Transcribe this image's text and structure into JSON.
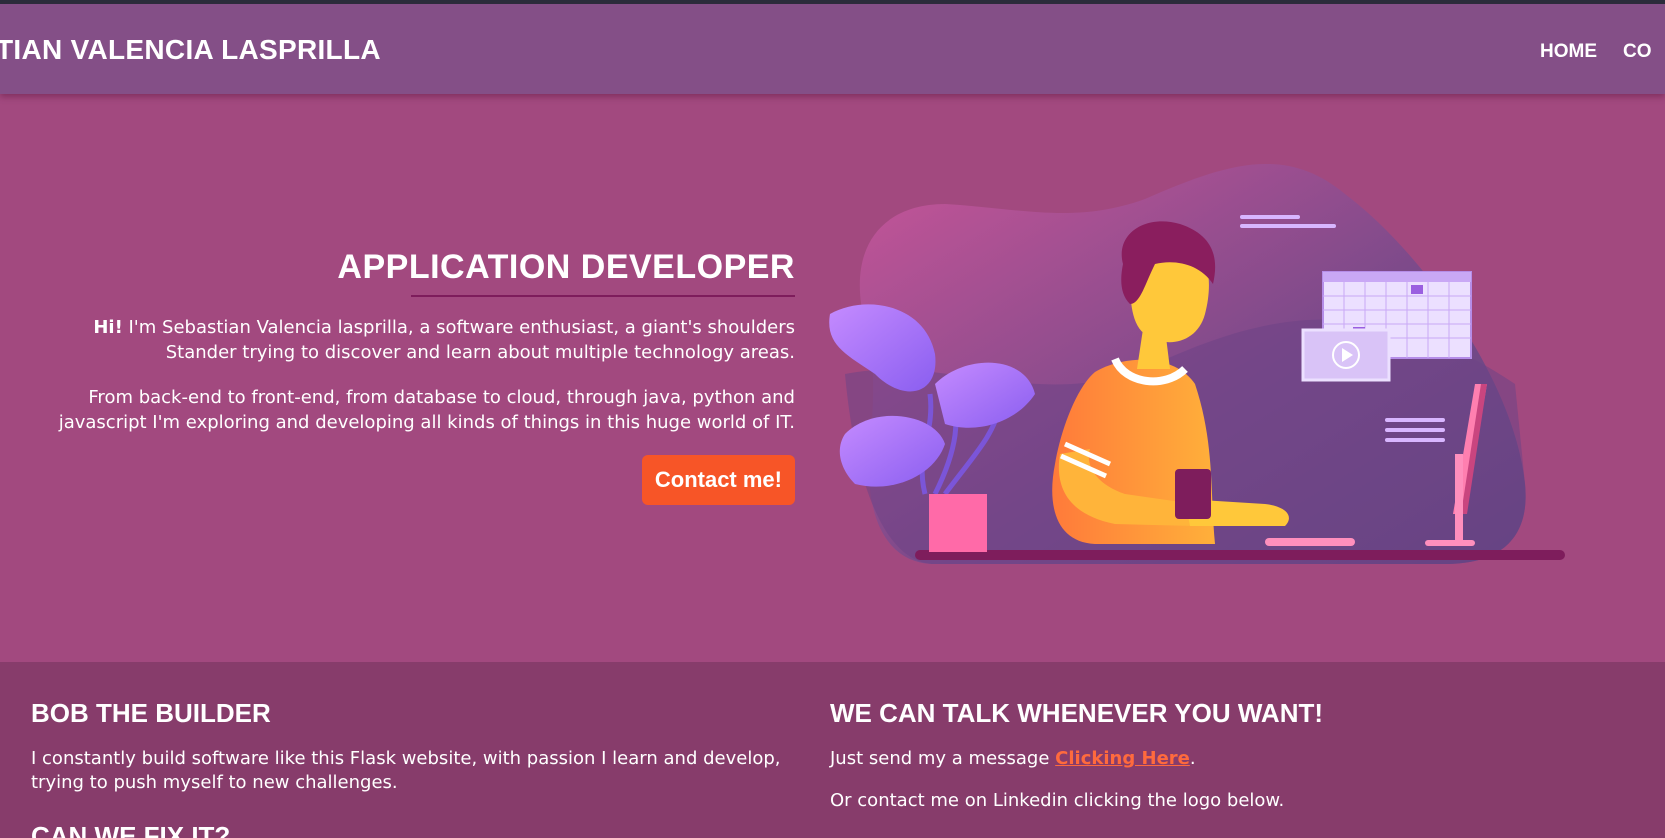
{
  "header": {
    "brand": "TIAN VALENCIA LASPRILLA",
    "nav": [
      "HOME",
      "CO"
    ]
  },
  "hero": {
    "title": "APPLICATION DEVELOPER",
    "intro_bold": "Hi!",
    "intro_rest": " I'm Sebastian Valencia lasprilla, a software enthusiast, a giant's shoulders Stander trying to discover and learn about multiple technology areas.",
    "paragraph2": "From back-end to front-end, from database to cloud, through java, python and javascript I'm exploring and developing all kinds of things in this huge world of IT.",
    "button": "Contact me!"
  },
  "left_col": {
    "heading": "BOB THE BUILDER",
    "text": "I constantly build software like this Flask website, with passion I learn and develop, trying to push myself to new challenges.",
    "heading2": "CAN WE FIX IT?"
  },
  "right_col": {
    "heading": "WE CAN TALK WHENEVER YOU WANT!",
    "line1_pre": "Just send my a message ",
    "line1_link": "Clicking Here",
    "line1_post": ".",
    "line2": "Or contact me on Linkedin clicking the logo below."
  },
  "colors": {
    "page_bg": "#a2497f",
    "header_bg": "#844f87",
    "lower_bg": "#873c6b",
    "accent": "#f75527",
    "link": "#ff6a3d"
  },
  "icons": [
    "plant-icon",
    "developer-illustration",
    "calendar-icon",
    "video-play-icon",
    "monitor-icon"
  ]
}
